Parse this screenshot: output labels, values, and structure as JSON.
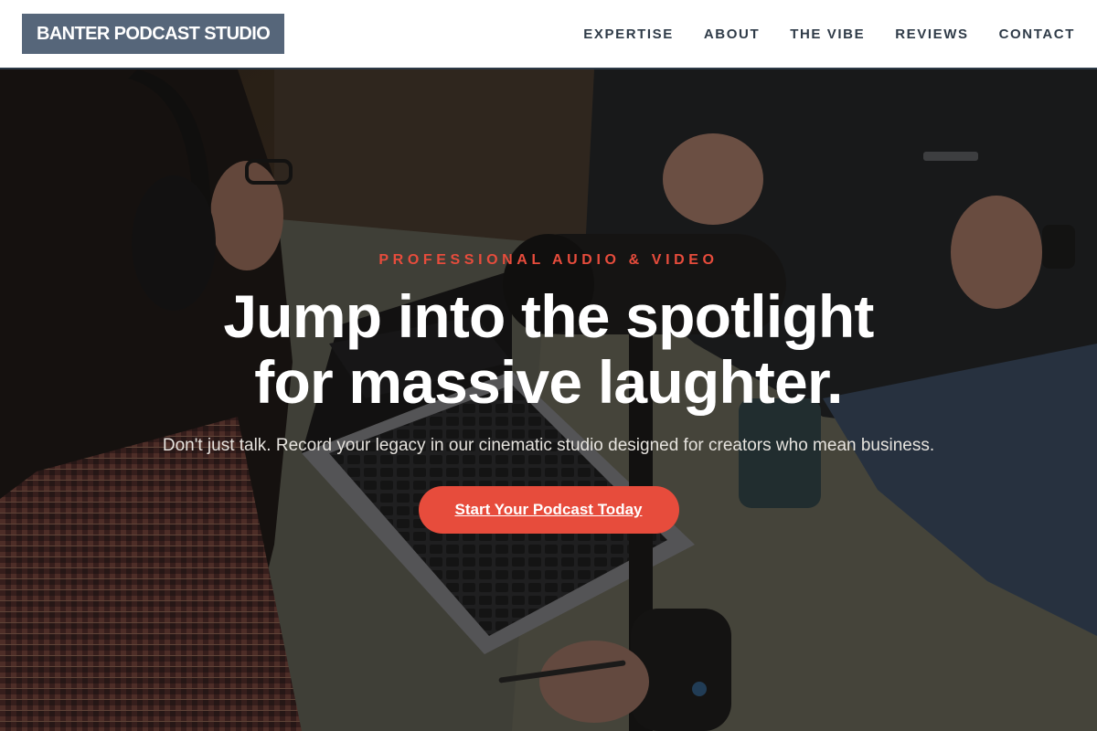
{
  "header": {
    "logo": "BANTER PODCAST STUDIO",
    "nav": [
      {
        "label": "EXPERTISE"
      },
      {
        "label": "ABOUT"
      },
      {
        "label": "THE VIBE"
      },
      {
        "label": "REVIEWS"
      },
      {
        "label": "CONTACT"
      }
    ]
  },
  "hero": {
    "eyebrow": "PROFESSIONAL AUDIO & VIDEO",
    "headline_line1": "Jump into the spotlight",
    "headline_line2": "for massive laughter.",
    "subtext": "Don't just talk. Record your legacy in our cinematic studio designed for creators who mean business.",
    "cta": "Start Your Podcast Today"
  },
  "colors": {
    "accent": "#e74c3c",
    "logo_bg": "#56667a",
    "nav_text": "#2f3b48",
    "overlay": "#161412"
  }
}
